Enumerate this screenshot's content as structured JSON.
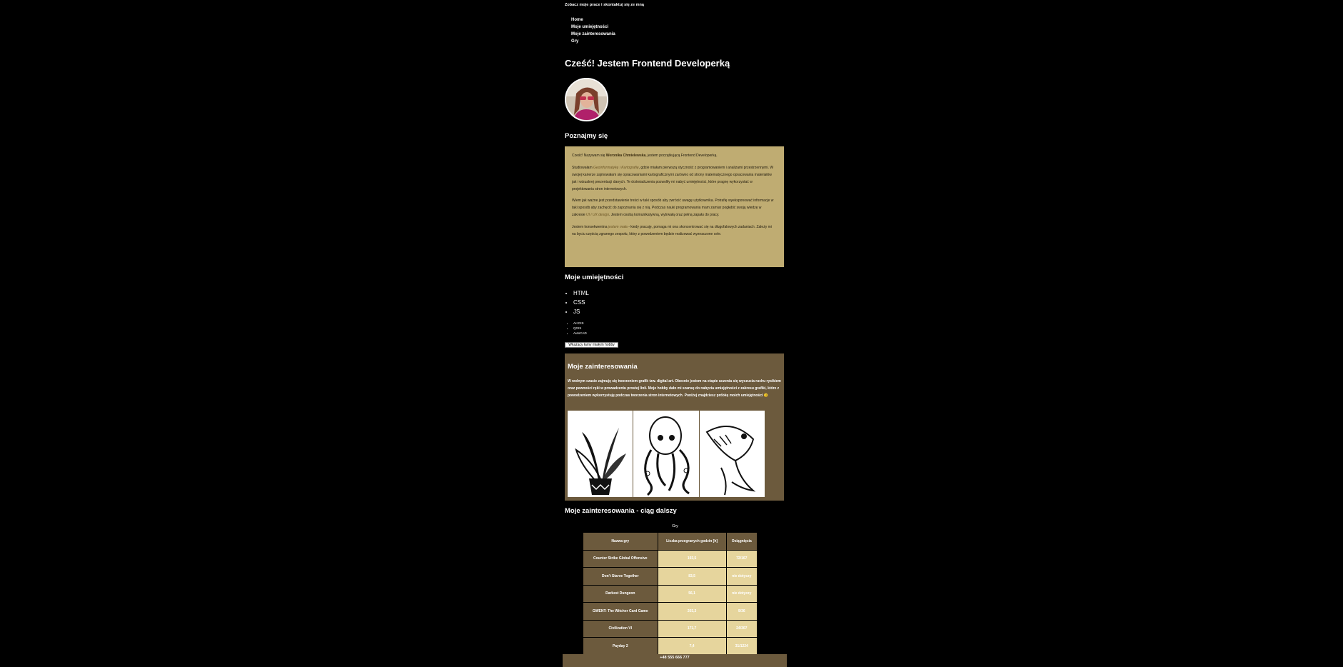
{
  "header": {
    "intro": "Zobacz moje prace i skontaktuj się ze mną"
  },
  "nav": {
    "items": [
      "Home",
      "Moje umiejętności",
      "Moje zainteresowania",
      "Gry"
    ]
  },
  "hero": {
    "title": "Cześć! Jestem Frontend Developerką"
  },
  "about": {
    "heading": "Poznajmy się",
    "p1_pre": "Cześć! Nazywam się ",
    "p1_name": "Weronika Chmielewska",
    "p1_post": ", jestem początkującą Frontend Developerką.",
    "p2_pre": "Studiowałam ",
    "p2_highlight": "Geoinformatykę i Kartografię",
    "p2_post": ", gdzie miałam pierwszą styczność z programowaniem i analizami przestrzennymi. W swojej karierze zajmowałam się opracowaniami kartograficznymi zarówno od strony matematycznego opracowania materiałów jak i wizualnej prezentacji danych. Te doświadczenia pozwoliły mi nabyć umiejętności, które pragnę wykorzystać w projektowaniu stron internetowych.",
    "p3_pre": "Wiem jak ważne jest przedstawienie treści w taki sposób aby zwrócić uwagę użytkownika. Potrafię wyeksponować informacje w taki sposób aby zachęcić do zapoznania się z nią. Podczas nauki programowania mam zamiar pogłębić swoją wiedzę w zakresie ",
    "p3_highlight": "UI i UX design",
    "p3_post": ". Jestem osobą komunikatywną, wytrwałą oraz pełną zapału do pracy.",
    "p4_pre": "Jestem konsekwentna ",
    "p4_highlight": "jestem mała",
    "p4_post": " - kiedy pracuję, pomaga mi ona skoncentrować się na długofalowych zadaniach. Zależy mi na byciu częścią zgranego zespołu, który z powodzeniem będzie realizować wyznaczone cele."
  },
  "skills": {
    "heading": "Moje umiejętności",
    "main": [
      "HTML",
      "CSS",
      "JS"
    ],
    "extra": [
      "ArcGIS",
      "QGIS",
      "AutoCAD"
    ],
    "button_label": "Wkażący łamy miałym hobby"
  },
  "hobbies": {
    "heading": "Moje zainteresowania",
    "text": "W wolnym czasie zajmuję się tworzeniem grafik tzw. digital art. Obecnie jestem na etapie uczenia się wyczucia ruchu rysikiem oraz pewności ręki w prowadzeniu prostej linii. Moje hobby dało mi szansę do nabycia umiejętności z zakresu grafiki, które z powodzeniem wykorzystuję podczas tworzenia stron internetowych. Poniżej znajdziesz próbkę moich umiejętności 😉",
    "gallery": [
      "plant-drawing",
      "octopus-drawing",
      "fish-drawing"
    ]
  },
  "games": {
    "heading": "Moje zainteresowania - ciąg dalszy",
    "caption": "Gry",
    "columns": [
      "Nazwa gry",
      "Liczba przegranych godzin [h]",
      "Osiągnięcia"
    ],
    "rows": [
      {
        "name": "Counter Strike Global Offensive",
        "hours": "193,5",
        "achievements": "72/167"
      },
      {
        "name": "Don't Starve Together",
        "hours": "83,5",
        "achievements": "nie dotyczy"
      },
      {
        "name": "Darkest Dungeon",
        "hours": "56,1",
        "achievements": "nie dotyczy"
      },
      {
        "name": "GWENT: The Witcher Card Game",
        "hours": "203,3",
        "achievements": "9/36"
      },
      {
        "name": "Civilization VI",
        "hours": "171,7",
        "achievements": "24/307"
      },
      {
        "name": "Payday 2",
        "hours": "7,4",
        "achievements": "31/1224"
      }
    ]
  },
  "footer": {
    "phone": "+48 555 666 777"
  },
  "colors": {
    "background": "#000000",
    "gold": "#bfac72",
    "brown": "#6c5a3d",
    "cream": "#e6d59d"
  }
}
